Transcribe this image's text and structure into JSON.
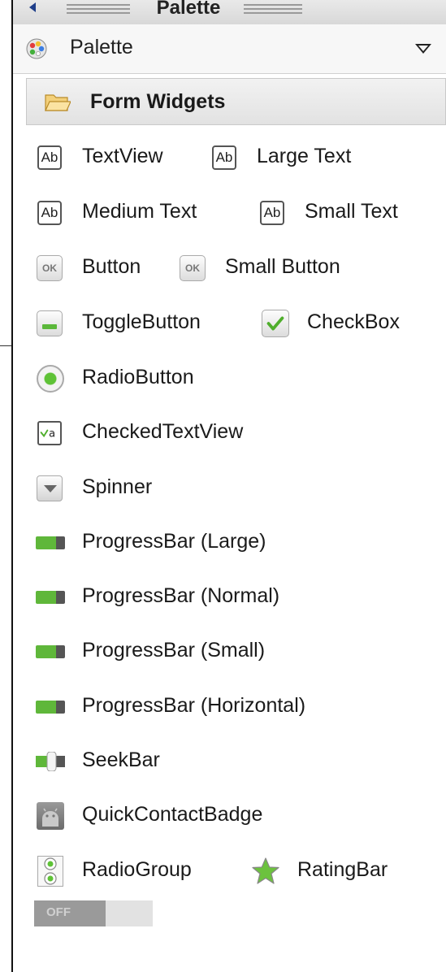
{
  "panel": {
    "title": "Palette"
  },
  "selector": {
    "label": "Palette"
  },
  "category": {
    "label": "Form Widgets"
  },
  "icons": {
    "ab": "Ab",
    "ok": "OK"
  },
  "widgets": {
    "textview": "TextView",
    "large_text": "Large Text",
    "medium_text": "Medium Text",
    "small_text": "Small Text",
    "button": "Button",
    "small_button": "Small Button",
    "togglebutton": "ToggleButton",
    "checkbox": "CheckBox",
    "radiobutton": "RadioButton",
    "checkedtextview": "CheckedTextView",
    "spinner": "Spinner",
    "progress_large": "ProgressBar (Large)",
    "progress_normal": "ProgressBar (Normal)",
    "progress_small": "ProgressBar (Small)",
    "progress_horizontal": "ProgressBar (Horizontal)",
    "seekbar": "SeekBar",
    "quickcontactbadge": "QuickContactBadge",
    "radiogroup": "RadioGroup",
    "ratingbar": "RatingBar"
  },
  "switch": {
    "label": "OFF"
  },
  "colors": {
    "accent_green": "#5fb73a",
    "title_arrow": "#1f3f8a"
  }
}
